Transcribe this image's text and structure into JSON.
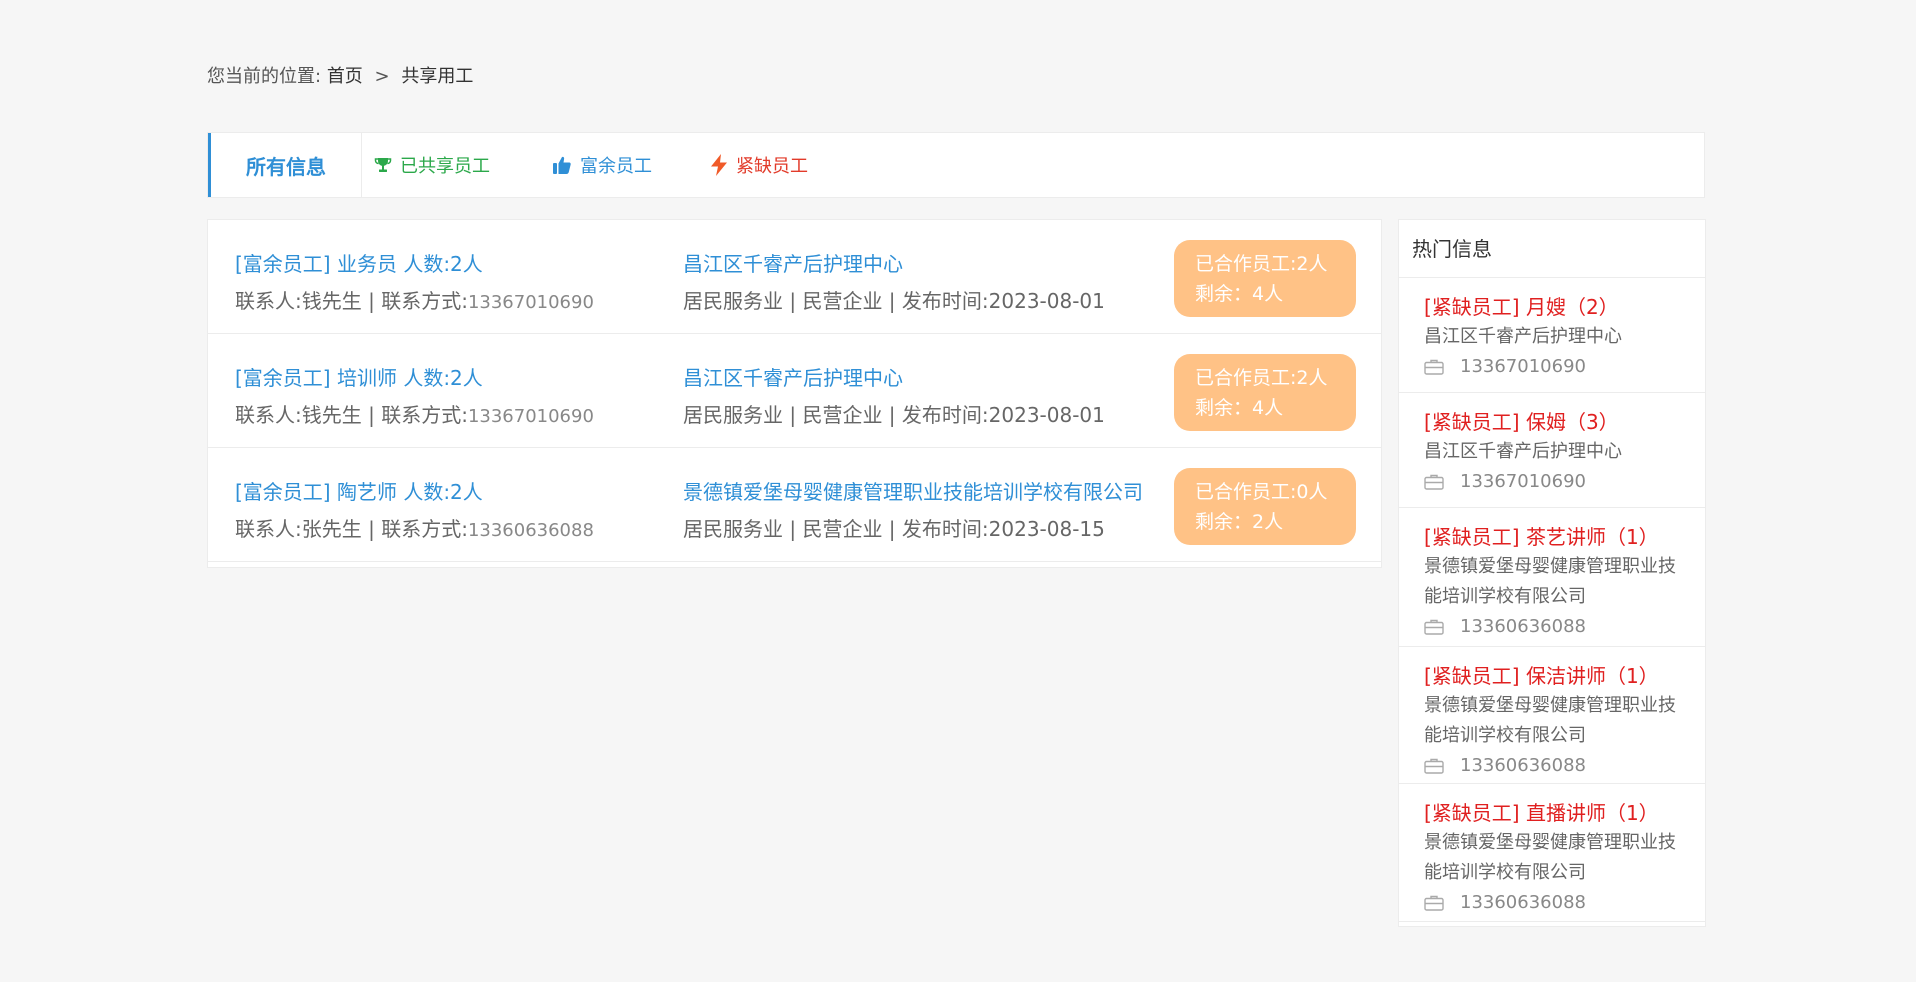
{
  "breadcrumb": {
    "prefix": "您当前的位置:",
    "home": "首页",
    "separator": ">",
    "current": "共享用工"
  },
  "tabs": {
    "all": "所有信息",
    "shared": {
      "label": "已共享员工",
      "icon": "trophy-icon",
      "color": "#2ba84a"
    },
    "surplus": {
      "label": "富余员工",
      "icon": "thumbs-up-icon",
      "color": "#2f8fd6"
    },
    "shortage": {
      "label": "紧缺员工",
      "icon": "lightning-icon",
      "color": "#e23b2a"
    }
  },
  "list": {
    "rows": [
      {
        "title": "[富余员工] 业务员 人数:2人",
        "contact_prefix": "联系人:钱先生 | 联系方式:",
        "phone": "13367010690",
        "company": "昌江区千睿产后护理中心",
        "meta": "居民服务业 | 民营企业 | 发布时间:2023-08-01",
        "cooperated": "已合作员工:2人",
        "remaining": "剩余：4人"
      },
      {
        "title": "[富余员工] 培训师 人数:2人",
        "contact_prefix": "联系人:钱先生 | 联系方式:",
        "phone": "13367010690",
        "company": "昌江区千睿产后护理中心",
        "meta": "居民服务业 | 民营企业 | 发布时间:2023-08-01",
        "cooperated": "已合作员工:2人",
        "remaining": "剩余：4人"
      },
      {
        "title": "[富余员工] 陶艺师 人数:2人",
        "contact_prefix": "联系人:张先生 | 联系方式:",
        "phone": "13360636088",
        "company": "景德镇爱堡母婴健康管理职业技能培训学校有限公司",
        "meta": "居民服务业 | 民营企业 | 发布时间:2023-08-15",
        "cooperated": "已合作员工:0人",
        "remaining": "剩余：2人"
      }
    ]
  },
  "hot": {
    "title": "热门信息",
    "items": [
      {
        "title": "[紧缺员工] 月嫂（2）",
        "company": "昌江区千睿产后护理中心",
        "phone": "13367010690"
      },
      {
        "title": "[紧缺员工] 保姆（3）",
        "company": "昌江区千睿产后护理中心",
        "phone": "13367010690"
      },
      {
        "title": "[紧缺员工] 茶艺讲师（1）",
        "company": "景德镇爱堡母婴健康管理职业技能培训学校有限公司",
        "phone": "13360636088"
      },
      {
        "title": "[紧缺员工] 保洁讲师（1）",
        "company": "景德镇爱堡母婴健康管理职业技能培训学校有限公司",
        "phone": "13360636088"
      },
      {
        "title": "[紧缺员工] 直播讲师（1）",
        "company": "景德镇爱堡母婴健康管理职业技能培训学校有限公司",
        "phone": "13360636088"
      }
    ]
  },
  "colors": {
    "accent": "#2f8fd6",
    "badge": "#ffc286",
    "hot_title": "#e02020"
  }
}
